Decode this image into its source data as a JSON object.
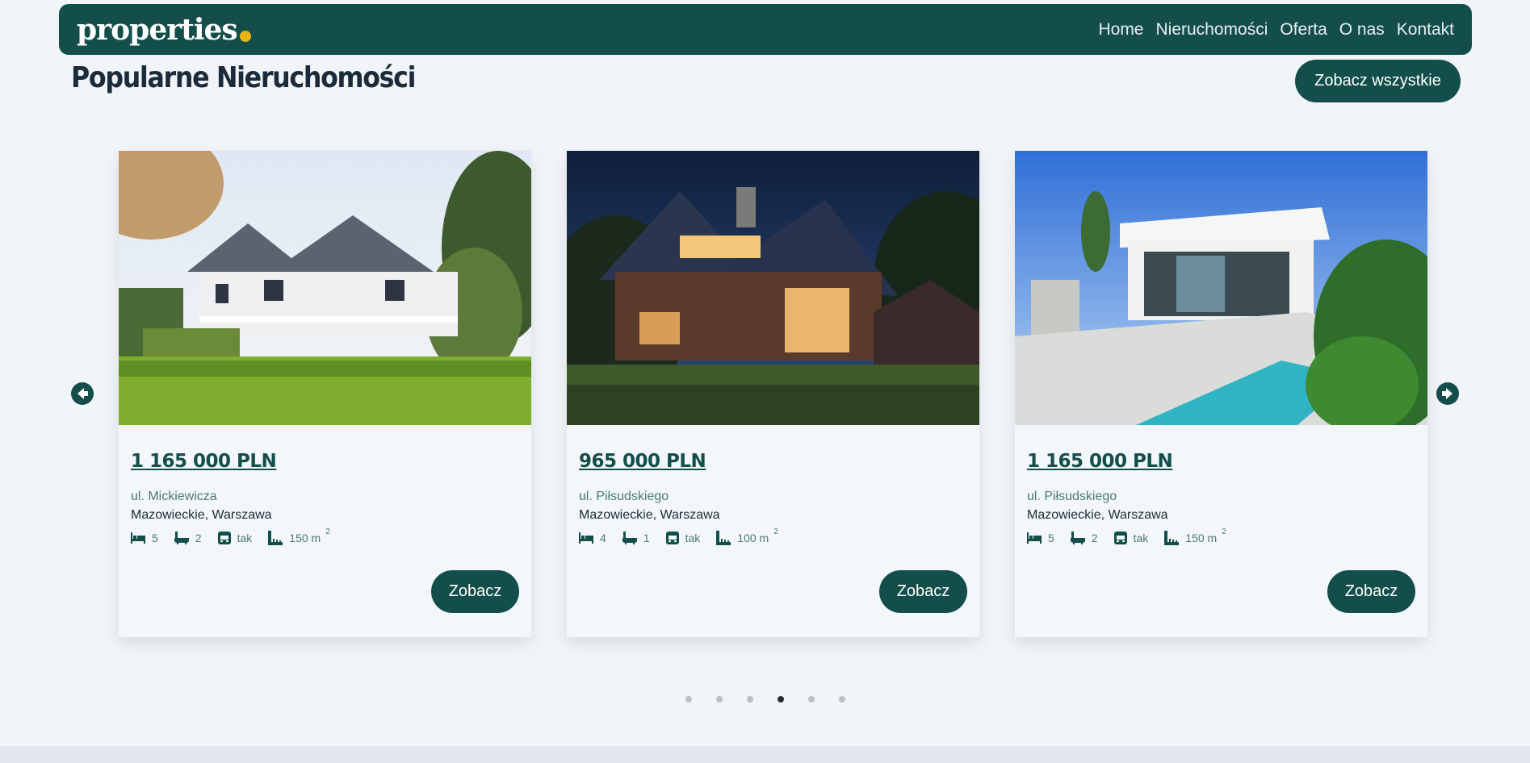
{
  "header": {
    "logo": "properties",
    "nav": [
      "Home",
      "Nieruchomości",
      "Oferta",
      "O nas",
      "Kontakt"
    ]
  },
  "section": {
    "title": "Popularne Nieruchomości",
    "see_all": "Zobacz wszystkie"
  },
  "cards": [
    {
      "price": "1 165 000 PLN",
      "street": "ul. Mickiewicza",
      "region": "Mazowieckie, Warszawa",
      "beds": "5",
      "baths": "2",
      "parking": "tak",
      "area": "150 m",
      "area_unit_sup": "2",
      "button": "Zobacz"
    },
    {
      "price": "965 000 PLN",
      "street": "ul. Piłsudskiego",
      "region": "Mazowieckie, Warszawa",
      "beds": "4",
      "baths": "1",
      "parking": "tak",
      "area": "100 m",
      "area_unit_sup": "2",
      "button": "Zobacz"
    },
    {
      "price": "1 165 000 PLN",
      "street": "ul. Piłsudskiego",
      "region": "Mazowieckie, Warszawa",
      "beds": "5",
      "baths": "2",
      "parking": "tak",
      "area": "150 m",
      "area_unit_sup": "2",
      "button": "Zobacz"
    }
  ],
  "carousel": {
    "dot_count": 6,
    "active_dot_index": 3
  },
  "colors": {
    "brand": "#134e4a",
    "accent": "#e8b314",
    "background": "#f1f4f9"
  },
  "icons": [
    "arrow-left-icon",
    "arrow-right-icon",
    "bed-icon",
    "bath-icon",
    "garage-icon",
    "area-icon"
  ]
}
